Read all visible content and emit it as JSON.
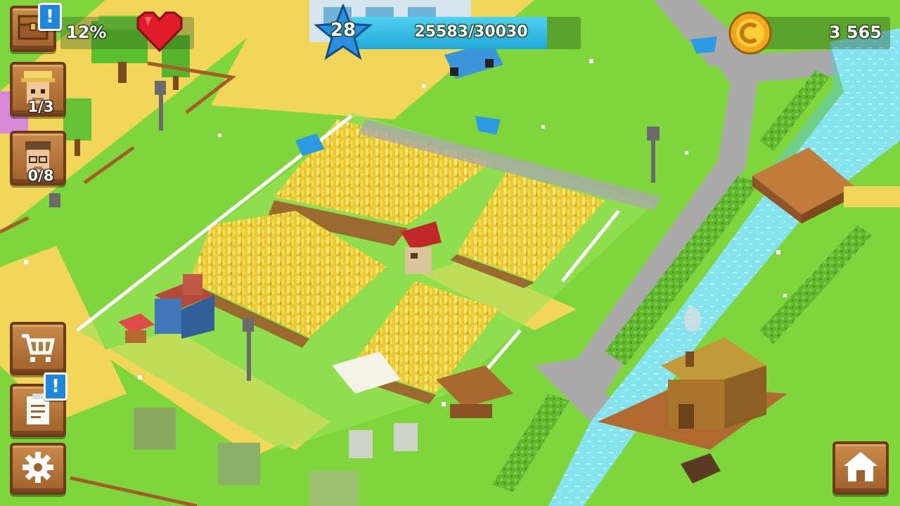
{
  "hud": {
    "chest_percent": "12%",
    "level": "28",
    "xp_text": "25583/30030",
    "xp_fraction": 0.852,
    "coins": "3 565",
    "villagers_count": "1/3",
    "visitors_count": "0/8",
    "alert_mark": "!"
  },
  "icons": {
    "chest": "chest-icon",
    "heart": "heart-icon",
    "level": "star-icon",
    "coin": "coin-icon",
    "villager": "villager-portrait-icon",
    "visitor": "visitor-portrait-icon",
    "shop": "cart-icon",
    "tasks": "clipboard-icon",
    "settings": "gear-icon",
    "home": "house-icon"
  },
  "colors": {
    "grass": "#7ed63c",
    "path": "#f2d65a",
    "wheat": "#f6dc45",
    "water": "#7fe6ee",
    "road": "#a8a8a8",
    "xp_bar": "#2fb8e0",
    "level_star": "#2a8fe0",
    "alert": "#1f86e0",
    "wood": "#a0612c"
  }
}
